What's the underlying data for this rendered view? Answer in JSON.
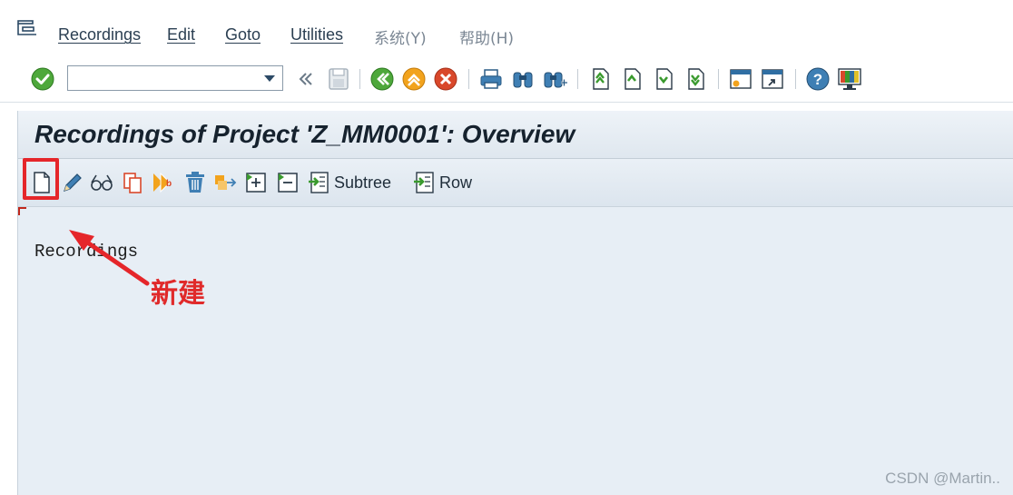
{
  "menubar": {
    "items": [
      {
        "label": "Recordings"
      },
      {
        "label": "Edit"
      },
      {
        "label": "Goto"
      },
      {
        "label": "Utilities"
      },
      {
        "label": "系统(Y)"
      },
      {
        "label": "帮助(H)"
      }
    ]
  },
  "command_field": {
    "value": "",
    "placeholder": ""
  },
  "screen": {
    "title": "Recordings of Project 'Z_MM0001': Overview"
  },
  "app_toolbar": {
    "subtree_label": "Subtree",
    "row_label": "Row"
  },
  "tree": {
    "root_label": "Recordings"
  },
  "annotation": {
    "label": "新建"
  },
  "watermark": "CSDN @Martin..",
  "colors": {
    "highlight": "#e5262a",
    "accent_green": "#3a9a2e",
    "accent_orange": "#f29a1d",
    "accent_red": "#d9482b"
  }
}
